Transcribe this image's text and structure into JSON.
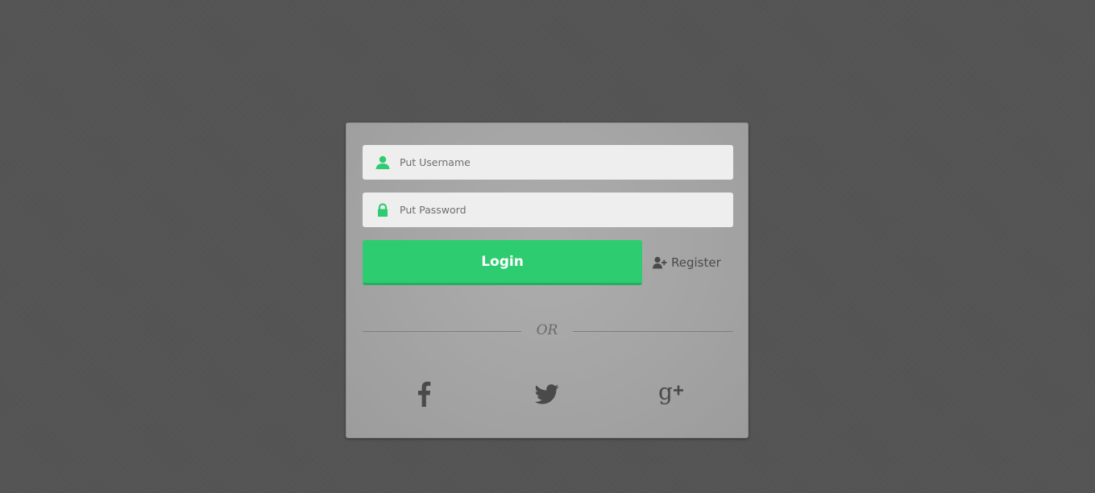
{
  "login_form": {
    "username_placeholder": "Put Username",
    "password_placeholder": "Put Password",
    "login_label": "Login",
    "register_label": "Register",
    "or_label": "OR"
  },
  "social": [
    {
      "name": "facebook",
      "icon": "facebook-icon"
    },
    {
      "name": "twitter",
      "icon": "twitter-icon"
    },
    {
      "name": "google-plus",
      "icon": "google-plus-icon"
    }
  ],
  "colors": {
    "accent": "#2ecc71",
    "background": "#545454",
    "card": "#a3a3a3",
    "input_background": "#eeeeee",
    "icon_dark": "#4a4a4a"
  }
}
